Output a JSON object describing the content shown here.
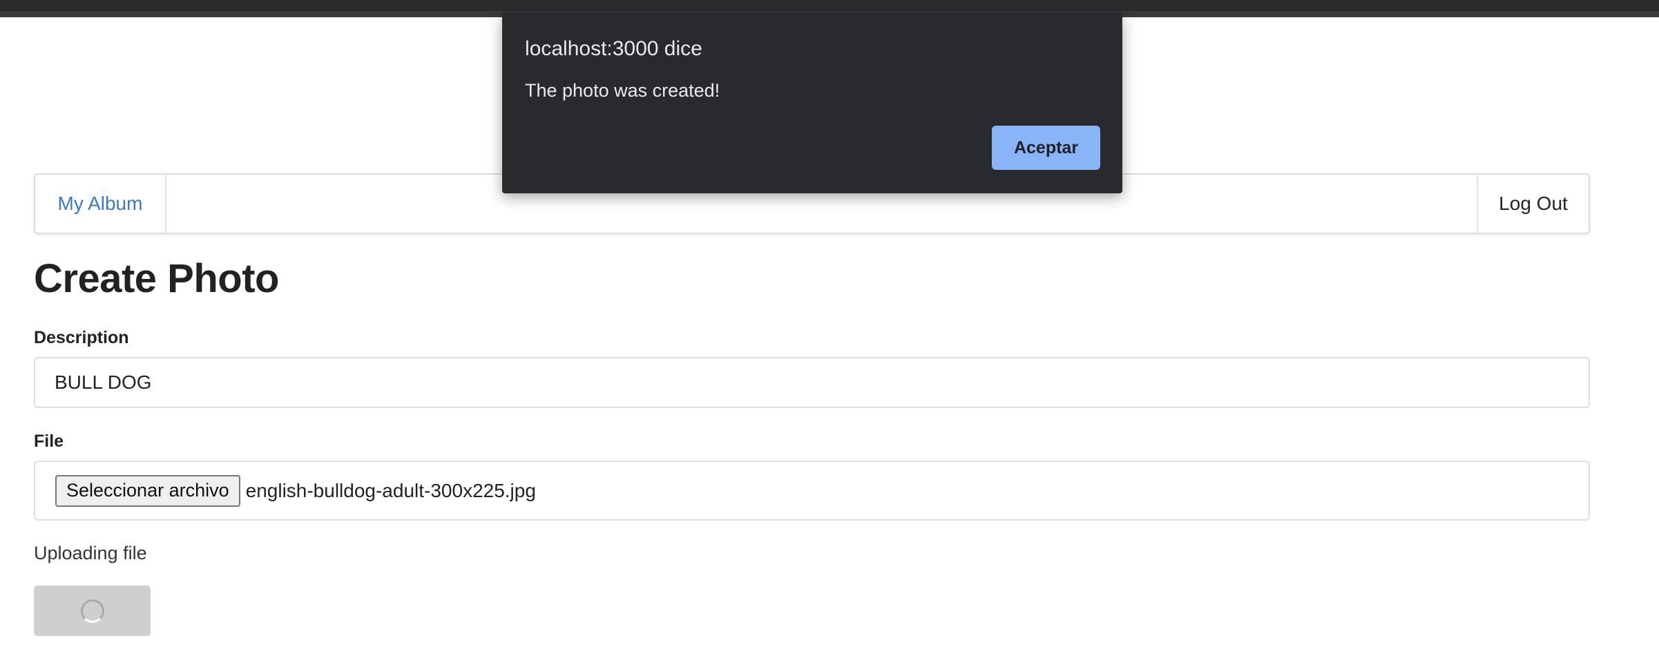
{
  "nav": {
    "album_link": "My Album",
    "logout": "Log Out"
  },
  "page": {
    "title": "Create Photo"
  },
  "form": {
    "description_label": "Description",
    "description_value": "BULL DOG",
    "file_label": "File",
    "file_button_label": "Seleccionar archivo",
    "file_name": "english-bulldog-adult-300x225.jpg",
    "uploading_text": "Uploading file"
  },
  "dialog": {
    "title": "localhost:3000 dice",
    "message": "The photo was created!",
    "ok_button": "Aceptar"
  },
  "colors": {
    "link": "#3b7ac2",
    "dialog_bg": "#292a2d",
    "dialog_button": "#8ab4f8",
    "spinner_button": "#cfcfd1"
  },
  "icons": {
    "loading": "spinner-icon"
  }
}
